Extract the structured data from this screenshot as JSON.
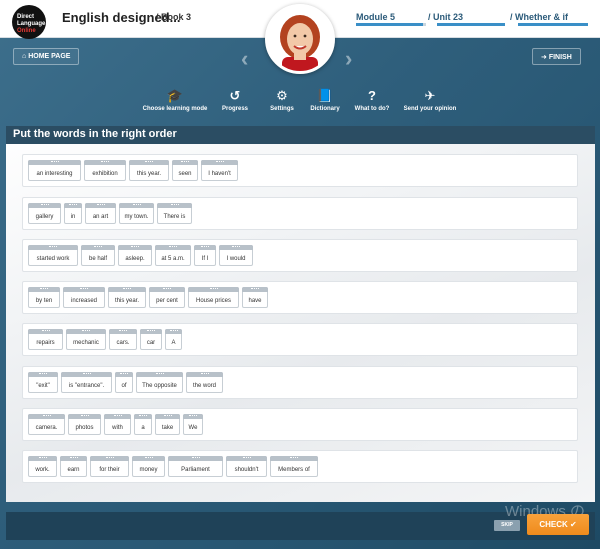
{
  "header": {
    "logo": {
      "line1": "Direct",
      "line2": "Language",
      "line3": "Online"
    },
    "title": "English designed...",
    "book": "/ Book 3",
    "crumbs": [
      {
        "label": "Module 5",
        "progress": 0.95
      },
      {
        "label": "/ Unit 23",
        "progress": 1.0
      },
      {
        "label": "/ Whether & if",
        "progress": 1.0
      }
    ],
    "home_label": "HOME PAGE",
    "finish_label": "FINISH"
  },
  "toolbar": {
    "items": [
      {
        "label": "Choose learning mode",
        "icon": "graduation-cap-icon"
      },
      {
        "label": "Progress",
        "icon": "history-icon"
      },
      {
        "label": "Settings",
        "icon": "gear-icon"
      },
      {
        "label": "Dictionary",
        "icon": "book-icon"
      },
      {
        "label": "What to do?",
        "icon": "question-icon"
      },
      {
        "label": "Send your opinion",
        "icon": "paper-plane-icon"
      }
    ]
  },
  "exercise": {
    "title": "Put the words in the right order",
    "rows": [
      [
        "an interesting",
        "exhibition",
        "this year.",
        "seen",
        "I haven't"
      ],
      [
        "gallery",
        "in",
        "an art",
        "my town.",
        "There is"
      ],
      [
        "started work",
        "be half",
        "asleep.",
        "at 5 a.m.",
        "If I",
        "I would"
      ],
      [
        "by ten",
        "increased",
        "this year.",
        "per cent",
        "House prices",
        "have"
      ],
      [
        "repairs",
        "mechanic",
        "cars.",
        "car",
        "A"
      ],
      [
        "\"exit\"",
        "is \"entrance\".",
        "of",
        "The opposite",
        "the word"
      ],
      [
        "camera.",
        "photos",
        "with",
        "a",
        "take",
        "We"
      ],
      [
        "work.",
        "earn",
        "for their",
        "money",
        "Parliament",
        "shouldn't",
        "Members of"
      ]
    ]
  },
  "footer": {
    "skip_label": "SKIP",
    "check_label": "CHECK ✔",
    "watermark": "Windows の"
  }
}
